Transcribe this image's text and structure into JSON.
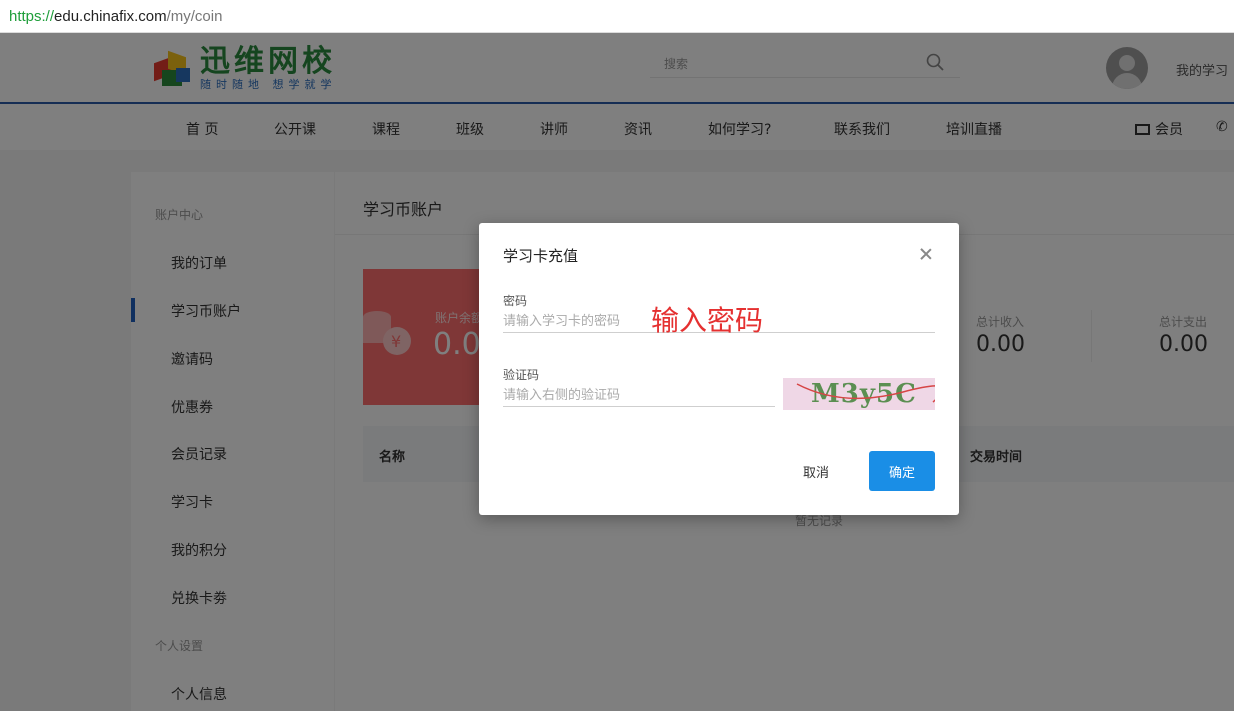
{
  "browser": {
    "url_scheme": "https://",
    "url_host": "edu.chinafix.com",
    "url_path": "/my/coin"
  },
  "header": {
    "logo_title": "迅维网校",
    "logo_slogan": "随时随地 想学就学",
    "search_placeholder": "搜索",
    "search_icon": "search-icon",
    "my_study": "我的学习"
  },
  "nav": {
    "items": [
      "首 页",
      "公开课",
      "课程",
      "班级",
      "讲师",
      "资讯",
      "如何学习?",
      "联系我们",
      "培训直播"
    ],
    "member_label": "会员",
    "member_icon": "id-card-icon",
    "phone_icon": "phone-icon"
  },
  "sidebar": {
    "group_account": "账户中心",
    "items": [
      "我的订单",
      "学习币账户",
      "邀请码",
      "优惠券",
      "会员记录",
      "学习卡",
      "我的积分",
      "兑换卡劵"
    ],
    "group_personal": "个人设置",
    "personal_items": [
      "个人信息"
    ],
    "active": "学习币账户"
  },
  "main": {
    "title": "学习币账户",
    "balance_label": "账户余额",
    "balance_value": "0.00",
    "stats": [
      {
        "label": "总计收入",
        "value": "0.00"
      },
      {
        "label": "总计支出",
        "value": "0.00"
      }
    ],
    "table_headers": [
      "名称",
      "交易时间"
    ],
    "empty_text": "暂无记录"
  },
  "modal": {
    "title": "学习卡充值",
    "password_label": "密码",
    "password_placeholder": "请输入学习卡的密码",
    "annotation": "输入密码",
    "captcha_label": "验证码",
    "captcha_placeholder": "请输入右侧的验证码",
    "captcha_text": "M3y5C",
    "cancel_label": "取消",
    "ok_label": "确定"
  },
  "colors": {
    "brand_blue": "#2a5ba8",
    "primary_button": "#1a8ee6",
    "balance_card": "#ff6f6f",
    "annotation_red": "#e53030"
  }
}
